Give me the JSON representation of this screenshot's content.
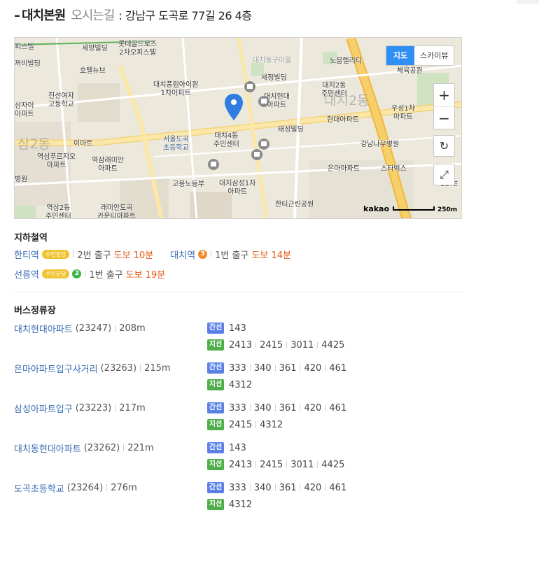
{
  "header": {
    "place_name": "대치본원",
    "place_sub": "오시는길",
    "address": ": 강남구 도곡로 77길 26 4층"
  },
  "map": {
    "toggle": [
      "지도",
      "스카이뷰"
    ],
    "zoom_in": "+",
    "zoom_out": "−",
    "brand": "kakao",
    "scale": "250m",
    "labels": {
      "l1": "피스텔",
      "l2": "세방빌딩",
      "l3": "롯데골드로즈\n2차오피스텔",
      "l4": "대치동구마을",
      "l5": "노블렐리티",
      "l6": "체육공원",
      "l7": "호텔뉴브",
      "l8": "꺼비빌딩",
      "l9": "대치풍림아이원\n1차아파트",
      "l10": "세정빌딩",
      "l11": "대치2동\n주민센터",
      "l12": "진선여자\n고등학교",
      "l13": "대치현대\n아파트",
      "l14": "대치2동",
      "l15": "우성1차\n아파트",
      "l16": "삼자이\n아파트",
      "l17": "대치4동\n주민센터",
      "l18": "태성빌딩",
      "l19": "현대아파트",
      "l20": "이마트",
      "l21": "서울도곡\n초등학교",
      "l22": "강남나무병원",
      "l23": "역삼푸르지오\n아파트",
      "l24": "역삼래미안\n아파트",
      "l25": "은마아파트",
      "l26": "스타벅스",
      "l27": "고용노동부",
      "l28": "대치삼성1차\n아파트",
      "l29": "병원",
      "l30": "역삼2동\n주민센터",
      "l31": "래미안도곡\n카운티아파트",
      "l32": "한티근린공원",
      "l33": "삼2동",
      "l34": "SETE"
    }
  },
  "subway": {
    "title": "지하철역",
    "rows": [
      [
        {
          "name": "한티역",
          "badge": "수인분당",
          "exit": "2번 출구",
          "walk": "도보 10분"
        },
        {
          "name": "대치역",
          "line": "3",
          "line_color": "#f08a2c",
          "exit": "1번 출구",
          "walk": "도보 14분"
        }
      ],
      [
        {
          "name": "선릉역",
          "badge": "수인분당",
          "line": "2",
          "line_color": "#3cb44a",
          "exit": "1번 출구",
          "walk": "도보 19분"
        }
      ]
    ]
  },
  "bus": {
    "title": "버스정류장",
    "trunk_label": "간선",
    "branch_label": "지선",
    "stops": [
      {
        "name": "대치현대아파트",
        "code": "(23247)",
        "dist": "208m",
        "trunk": [
          "143"
        ],
        "branch": [
          "2413",
          "2415",
          "3011",
          "4425"
        ]
      },
      {
        "name": "은마아파트입구사거리",
        "code": "(23263)",
        "dist": "215m",
        "trunk": [
          "333",
          "340",
          "361",
          "420",
          "461"
        ],
        "branch": [
          "4312"
        ]
      },
      {
        "name": "삼성아파트입구",
        "code": "(23223)",
        "dist": "217m",
        "trunk": [
          "333",
          "340",
          "361",
          "420",
          "461"
        ],
        "branch": [
          "2415",
          "4312"
        ]
      },
      {
        "name": "대치동현대아파트",
        "code": "(23262)",
        "dist": "221m",
        "trunk": [
          "143"
        ],
        "branch": [
          "2413",
          "2415",
          "3011",
          "4425"
        ]
      },
      {
        "name": "도곡초등학교",
        "code": "(23264)",
        "dist": "276m",
        "trunk": [
          "333",
          "340",
          "361",
          "420",
          "461"
        ],
        "branch": [
          "4312"
        ]
      }
    ]
  }
}
